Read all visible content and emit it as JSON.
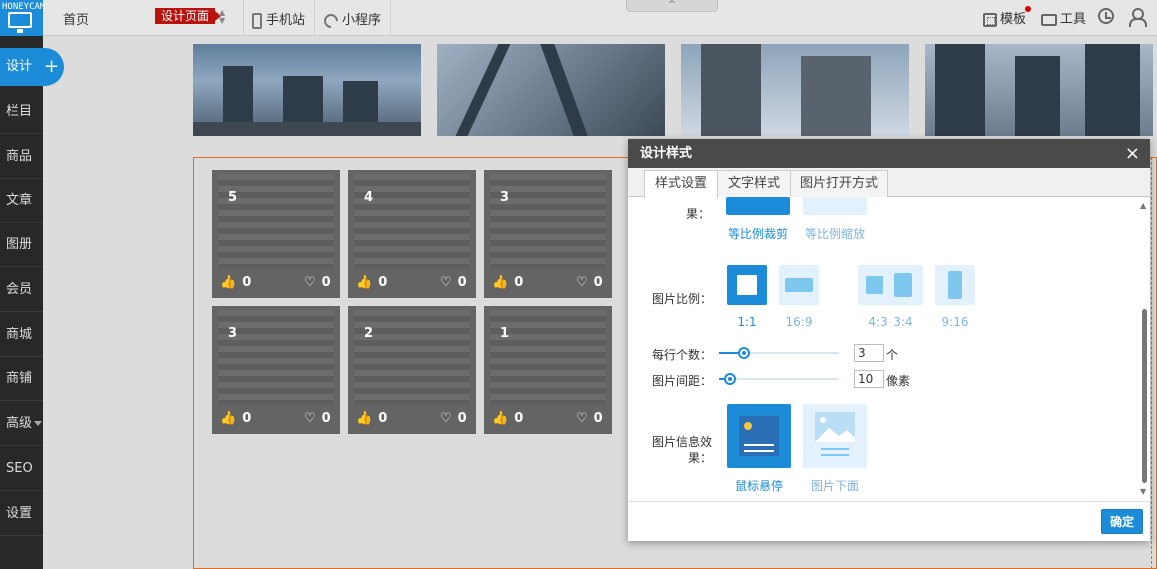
{
  "watermark": "HONEYCAM",
  "topbar": {
    "home": "首页",
    "page_badge": "设计页面",
    "mobile_site": "手机站",
    "mini_program": "小程序",
    "template": "模板",
    "tools": "工具"
  },
  "sidebar": {
    "design": "设计",
    "items": [
      "栏目",
      "商品",
      "文章",
      "图册",
      "会员",
      "商城",
      "商铺",
      "高级",
      "SEO",
      "设置"
    ]
  },
  "tiles": [
    {
      "num": "5",
      "likes": "0",
      "favs": "0"
    },
    {
      "num": "4",
      "likes": "0",
      "favs": "0"
    },
    {
      "num": "3",
      "likes": "0",
      "favs": "0"
    },
    {
      "num": "3",
      "likes": "0",
      "favs": "0"
    },
    {
      "num": "2",
      "likes": "0",
      "favs": "0"
    },
    {
      "num": "1",
      "likes": "0",
      "favs": "0"
    }
  ],
  "dialog": {
    "title": "设计样式",
    "close": "×",
    "tabs": [
      "样式设置",
      "文字样式",
      "图片打开方式"
    ],
    "effect_label_tail": "果：",
    "crop_options": [
      "等比例裁剪",
      "等比例缩放"
    ],
    "ratio_label": "图片比例：",
    "ratios": [
      "1:1",
      "16:9",
      "4:3",
      "3:4",
      "9:16"
    ],
    "per_row_label": "每行个数：",
    "per_row_value": "3",
    "per_row_unit": "个",
    "spacing_label": "图片间距：",
    "spacing_value": "10",
    "spacing_unit": "像素",
    "info_label_line1": "图片信息效",
    "info_label_line2": "果：",
    "info_options": [
      "鼠标悬停",
      "图片下面"
    ],
    "ok": "确定"
  },
  "colors": {
    "accent": "#1c8cd8",
    "badge": "#b8130f",
    "selection": "#e36b1f"
  }
}
